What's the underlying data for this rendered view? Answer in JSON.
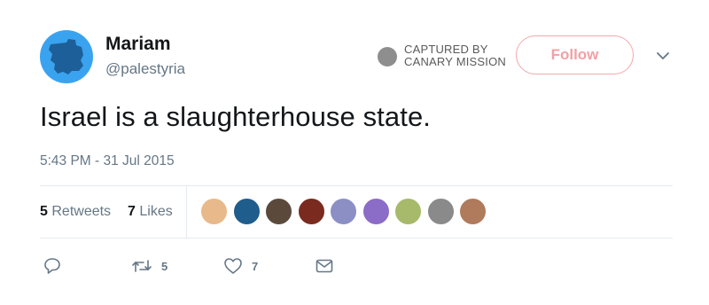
{
  "user": {
    "display_name": "Mariam",
    "handle": "@palestyria",
    "avatar_icon": "sudan-map-silhouette-icon",
    "avatar_color": "#3aa3ef"
  },
  "watermark": {
    "line1": "CAPTURED BY",
    "line2": "CANARY MISSION"
  },
  "follow_button": {
    "label": "Follow",
    "color": "#f2a0a6"
  },
  "tweet": {
    "text": "Israel is a slaughterhouse state.",
    "timestamp": "5:43 PM - 31 Jul 2015"
  },
  "stats": {
    "retweets_count": "5",
    "retweets_label": "Retweets",
    "likes_count": "7",
    "likes_label": "Likes"
  },
  "likers": [
    {
      "name": "liker-avatar-1",
      "color": "#e8b98a"
    },
    {
      "name": "liker-avatar-2",
      "color": "#1f5d8c"
    },
    {
      "name": "liker-avatar-3",
      "color": "#5b4a3c"
    },
    {
      "name": "liker-avatar-4",
      "color": "#7a2a1e"
    },
    {
      "name": "liker-avatar-5",
      "color": "#8c8fc4"
    },
    {
      "name": "liker-avatar-6",
      "color": "#8b6cc7"
    },
    {
      "name": "liker-avatar-7",
      "color": "#a7b96a"
    },
    {
      "name": "liker-avatar-8",
      "color": "#8a8a8a"
    },
    {
      "name": "liker-avatar-9",
      "color": "#b07a5c"
    }
  ],
  "actions": {
    "reply_icon": "reply-icon",
    "retweet_icon": "retweet-icon",
    "retweet_count": "5",
    "like_icon": "heart-icon",
    "like_count": "7",
    "dm_icon": "envelope-icon"
  }
}
